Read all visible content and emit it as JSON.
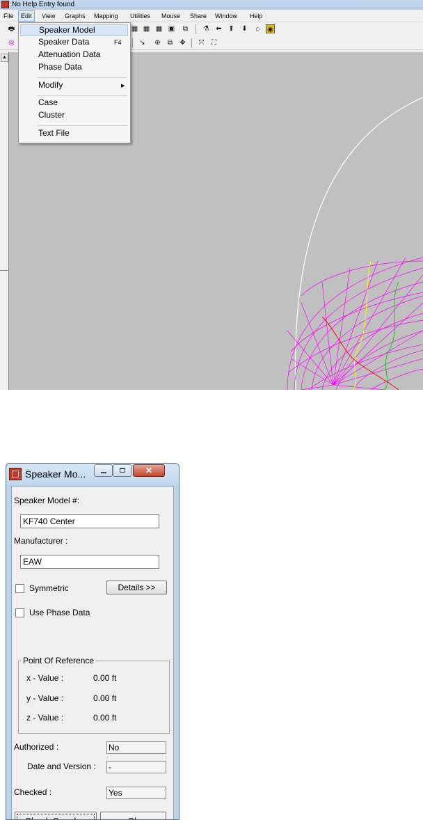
{
  "app": {
    "title": "No Help Entry found",
    "menu": [
      "File",
      "Edit",
      "View",
      "Graphs",
      "Mapping",
      "Utilities",
      "Mouse",
      "Share",
      "Window",
      "Help"
    ],
    "active_menu": "Edit",
    "edit_menu": {
      "items": [
        {
          "label": "Speaker Model",
          "shortcut": "",
          "submenu": false
        },
        {
          "label": "Speaker Data",
          "shortcut": "F4",
          "submenu": false
        },
        {
          "label": "Attenuation Data",
          "shortcut": "",
          "submenu": false
        },
        {
          "label": "Phase Data",
          "shortcut": "",
          "submenu": false
        },
        {
          "label": "Modify",
          "shortcut": "",
          "submenu": true
        },
        {
          "label": "Case",
          "shortcut": "",
          "submenu": false
        },
        {
          "label": "Cluster",
          "shortcut": "",
          "submenu": false
        },
        {
          "label": "Text File",
          "shortcut": "",
          "submenu": false
        }
      ],
      "highlighted": "Speaker Model"
    },
    "colors": {
      "canvas": "#c0c0c0",
      "wireframe_primary": "#ff00ff",
      "wireframe_secondary": "#ffff00",
      "wireframe_tertiary": "#00cc00",
      "wireframe_accent": "#ff0000",
      "coverage_arc": "#ffffff"
    }
  },
  "dialog": {
    "title": "Speaker Mo...",
    "speaker_model_label": "Speaker Model #:",
    "speaker_model_value": "KF740 Center",
    "manufacturer_label": "Manufacturer :",
    "manufacturer_value": "EAW",
    "symmetric_label": "Symmetric",
    "symmetric_checked": false,
    "details_button": "Details >>",
    "use_phase_label": "Use Phase Data",
    "use_phase_checked": false,
    "reference_group": "Point Of Reference",
    "x_label": "x - Value :",
    "x_value": "0.00 ft",
    "y_label": "y - Value :",
    "y_value": "0.00 ft",
    "z_label": "z - Value :",
    "z_value": "0.00 ft",
    "authorized_label": "Authorized :",
    "authorized_value": "No",
    "date_version_label": "Date and Version :",
    "date_version_value": "-",
    "checked_label": "Checked :",
    "checked_value": "Yes",
    "check_speaker_button": "Check Speaker",
    "ok_button": "Ok"
  }
}
